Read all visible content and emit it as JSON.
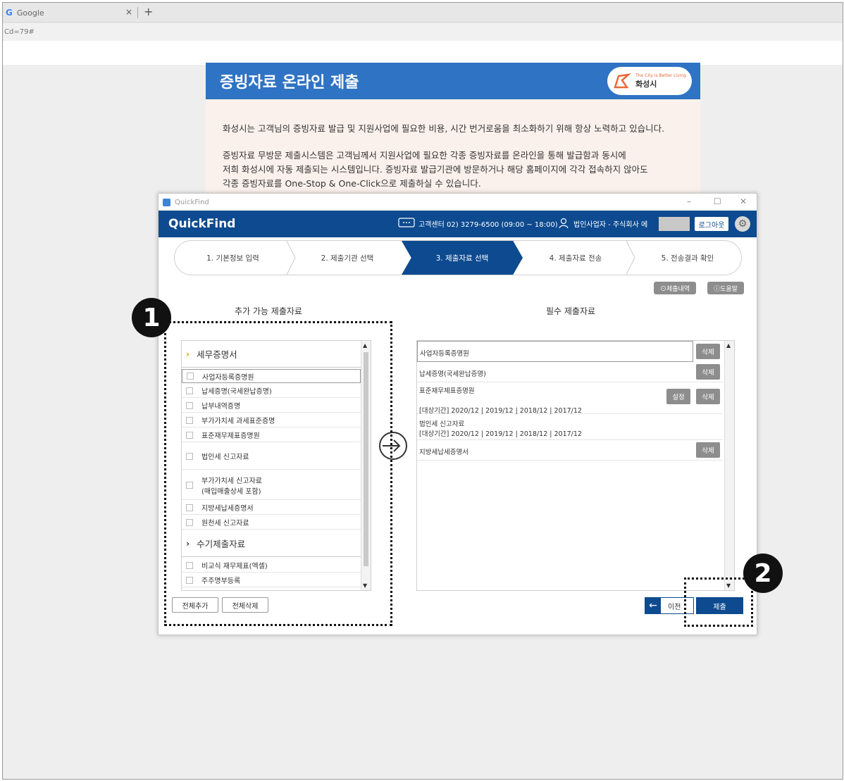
{
  "browser": {
    "tab_title": "Google",
    "tab_close": "×",
    "new_tab": "+",
    "url_fragment": "Cd=79#"
  },
  "site": {
    "title": "증빙자료 온라인 제출",
    "logo_tagline": "The City is Better Living",
    "logo_name": "화성시",
    "paragraph1": "화성시는 고객님의 증빙자료 발급 및 지원사업에 필요한 비용, 시간 번거로움을 최소화하기 위해 항상 노력하고 있습니다.",
    "paragraph2_line1": "증빙자료 무방문 제출시스템은 고객님께서 지원사업에 필요한 각종 증빙자료를 온라인을 통해 발급함과 동시에",
    "paragraph2_line2": "저희 화성시에 자동 제출되는 시스템입니다. 증빙자료 발급기관에 방문하거나 해당 홈페이지에 각각 접속하지 않아도",
    "paragraph2_line3": "각종 증빙자료를 One-Stop & One-Click으로 제출하실 수 있습니다."
  },
  "app": {
    "window_title": "QuickFind",
    "win_min": "–",
    "win_max": "☐",
    "win_close": "✕",
    "logo": "QuickFind",
    "support": "고객센터 02) 3279-6500 (09:00 ~ 18:00)",
    "user": "법인사업자 - 주식회사 에",
    "logout": "로그아웃",
    "steps": [
      {
        "label": "1. 기본정보 입력"
      },
      {
        "label": "2. 제출기관 선택"
      },
      {
        "label": "3. 제출자료 선택"
      },
      {
        "label": "4. 제출자료 전송"
      },
      {
        "label": "5. 전송결과 확인"
      }
    ],
    "history_btn": "⊙제출내역",
    "help_btn": "ⓘ도움말",
    "left_title": "추가 가능 제출자료",
    "right_title": "필수 제출자료",
    "group1": "세무증명서",
    "group1_items": [
      "사업자등록증명원",
      "납세증명(국세완납증명)",
      "납부내역증명",
      "부가가치세 과세표준증명",
      "표준재무제표증명원",
      "법인세 신고자료"
    ],
    "vat_line1": "부가가치세 신고자료",
    "vat_line2": "(매입매출상세 포함)",
    "group1_items_b": [
      "지방세납세증명서",
      "원천세 신고자료"
    ],
    "group2": "수기제출자료",
    "group2_items": [
      "비교식 재무제표(엑셀)",
      "주주명부등록"
    ],
    "add_all": "전체추가",
    "delete_all": "전체삭제",
    "required": {
      "r1": "사업자등록증명원",
      "r2": "납세증명(국세완납증명)",
      "r3": "표준재무제표증명원",
      "r3_period": "[대상기간] 2020/12 | 2019/12 | 2018/12 | 2017/12",
      "r4": "법인세 신고자료",
      "r4_period": "[대상기간] 2020/12 | 2019/12 | 2018/12 | 2017/12",
      "r5": "지방세납세증명서"
    },
    "delete_label": "삭제",
    "setting_label": "설정",
    "prev": "이전",
    "prev_icon": "←",
    "submit": "제출"
  },
  "annotations": {
    "badge1": "1",
    "badge2": "2"
  }
}
